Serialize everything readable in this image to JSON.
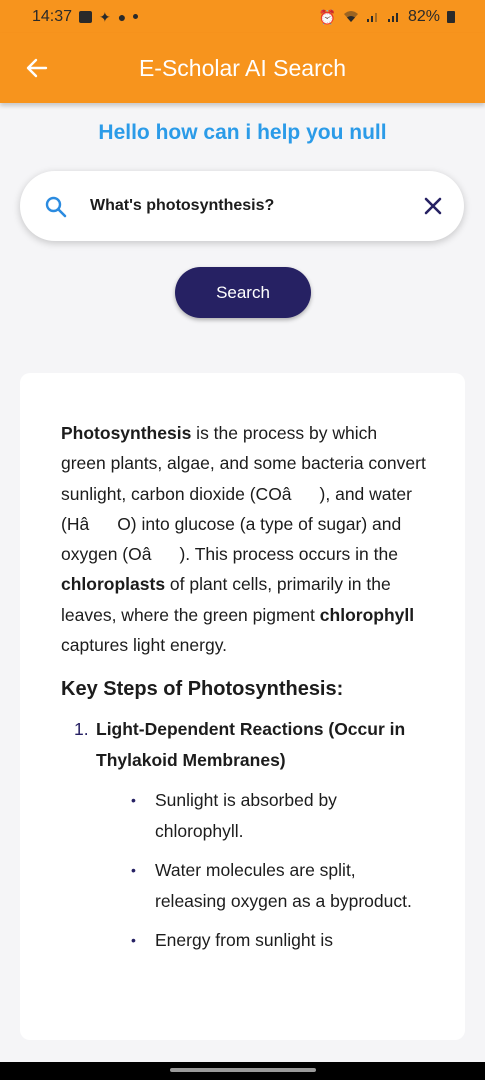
{
  "status_bar": {
    "time": "14:37",
    "battery": "82%",
    "left_icons": [
      "gallery-icon",
      "sparkle-icon",
      "chat-icon",
      "dot-icon"
    ],
    "right_icons": [
      "alarm-icon",
      "wifi-icon",
      "signal-icon",
      "signal-icon",
      "battery-icon"
    ]
  },
  "app_bar": {
    "title": "E-Scholar AI Search",
    "back_icon": "arrow-left-icon",
    "color": "#f7941d"
  },
  "greeting": "Hello how can i help you null",
  "search": {
    "value": "What's photosynthesis?",
    "icon": "search-icon",
    "clear_icon": "close-icon",
    "button_label": "Search"
  },
  "answer": {
    "intro": {
      "term": "Photosynthesis",
      "text_1": " is the process by which green plants, algae, and some bacteria convert sunlight, carbon dioxide (COâ), and water (HâO) into glucose (a type of sugar) and oxygen (Oâ). This process occurs in the ",
      "bold_1": "chloroplasts",
      "text_2": " of plant cells, primarily in the leaves, where the green pigment ",
      "bold_2": "chlorophyll",
      "text_3": " captures light energy."
    },
    "heading": "Key Steps of Photosynthesis:",
    "step_1": {
      "number": "1.",
      "title": "Light-Dependent Reactions (Occur in Thylakoid Membranes)",
      "bullets": [
        "Sunlight is absorbed by chlorophyll.",
        "Water molecules are split, releasing oxygen as a byproduct.",
        "Energy from sunlight is"
      ]
    }
  },
  "colors": {
    "accent": "#f7941d",
    "greeting": "#2b9be8",
    "button": "#262163",
    "search_icon": "#2b8be0"
  }
}
